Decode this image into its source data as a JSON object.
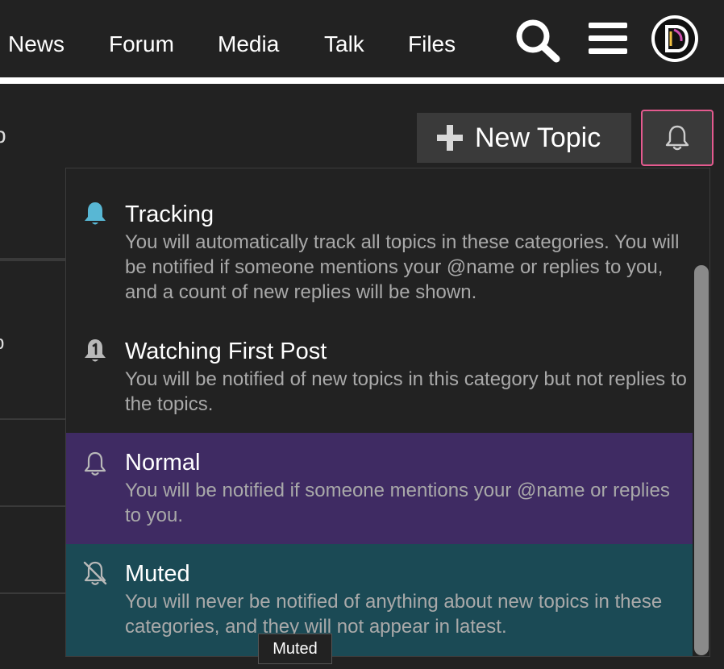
{
  "header": {
    "nav": [
      "News",
      "Forum",
      "Media",
      "Talk",
      "Files"
    ],
    "icons": [
      "search-icon",
      "hamburger-menu-icon"
    ]
  },
  "background": {
    "fragment_1": "p",
    "fragment_2": "p"
  },
  "controls": {
    "new_topic_label": "New Topic",
    "notification_button_icon": "bell-icon"
  },
  "dropdown": {
    "options": [
      {
        "title": "Tracking",
        "description": "You will automatically track all topics in these categories. You will be notified if someone mentions your @name or replies to you, and a count of new replies will be shown.",
        "icon": "bell-filled-icon",
        "icon_color": "#58b7d4"
      },
      {
        "title": "Watching First Post",
        "description": "You will be notified of new topics in this category but not replies to the topics.",
        "icon": "bell-one-icon",
        "icon_color": "#b9b9b9"
      },
      {
        "title": "Normal",
        "description": "You will be notified if someone mentions your @name or replies to you.",
        "icon": "bell-outline-icon",
        "icon_color": "#b9b9b9",
        "highlight": "#3f2b63"
      },
      {
        "title": "Muted",
        "description": "You will never be notified of anything about new topics in these categories, and they will not appear in latest.",
        "icon": "bell-slash-icon",
        "icon_color": "#b9b9b9",
        "highlight": "#1b4a55"
      }
    ]
  },
  "tooltip": {
    "text": "Muted"
  },
  "colors": {
    "background": "#222222",
    "accent_border": "#e45a8f",
    "button_bg": "#3a3a3a",
    "muted_text": "#a9a9a9"
  }
}
